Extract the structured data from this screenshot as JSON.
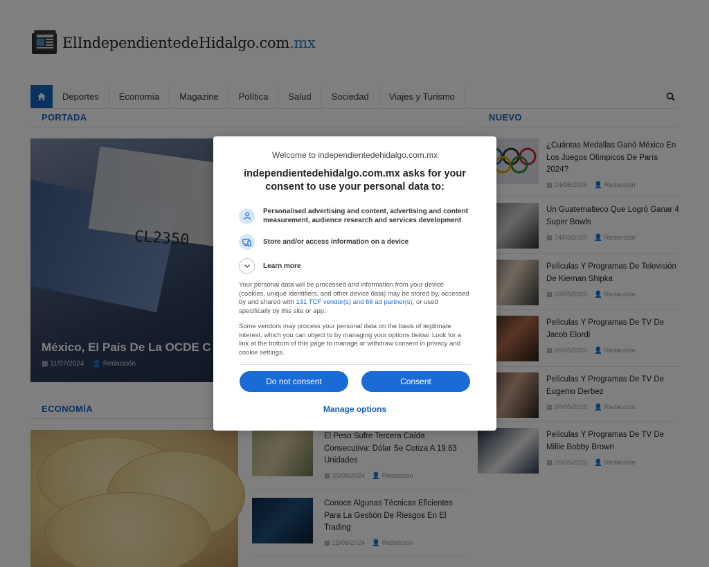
{
  "site": {
    "logo_main": "ElIndependientedeHidalgo.com",
    "logo_tld": ".mx"
  },
  "nav": {
    "items": [
      "Deportes",
      "Economía",
      "Magazine",
      "Política",
      "Salud",
      "Sociedad",
      "Viajes y Turismo"
    ]
  },
  "sections": {
    "portada": "PORTADA",
    "nuevo": "NUEVO",
    "economia": "ECONOMÍA"
  },
  "hero": {
    "serial": "CL2350",
    "title": "México, El País De La OCDE C",
    "date": "11/07/2024",
    "author": "Redacción"
  },
  "nuevo": [
    {
      "title": "¿Cuántas Medallas Ganó México En Los Juegos Olímpicos De París 2024?",
      "date": "24/05/2025",
      "author": "Redacción"
    },
    {
      "title": "Un Guatemalteco Que Logró Ganar 4 Super Bowls",
      "date": "24/05/2025",
      "author": "Redacción"
    },
    {
      "title": "Películas Y Programas De Televisión De Kiernan Shipka",
      "date": "20/05/2025",
      "author": "Redacción"
    },
    {
      "title": "Películas Y Programas De TV De Jacob Elordi",
      "date": "20/05/2025",
      "author": "Redacción"
    },
    {
      "title": "Películas Y Programas De TV De Eugenio Derbez",
      "date": "20/05/2025",
      "author": "Redacción"
    },
    {
      "title": "Películas Y Programas De TV De Millie Bobby Brown",
      "date": "20/05/2025",
      "author": "Redacción"
    }
  ],
  "economia_list": [
    {
      "title": "El Peso Sufre Tercera Caída Consecutiva: Dólar Se Cotiza A 19.83 Unidades",
      "date": "30/08/2024",
      "author": "Redacción"
    },
    {
      "title": "Conoce Algunas Técnicas Eficientes Para La Gestión De Riesgos En El Trading",
      "date": "12/08/2024",
      "author": "Redacción"
    }
  ],
  "consent": {
    "welcome": "Welcome to independientedehidalgo.com.mx",
    "heading": "independientedehidalgo.com.mx asks for your consent to use your personal data to:",
    "purpose_1": "Personalised advertising and content, advertising and content measurement, audience research and services development",
    "purpose_2": "Store and/or access information on a device",
    "learn_more": "Learn more",
    "para_1_a": "Your personal data will be processed and information from your device (cookies, unique identifiers, and other device data) may be stored by, accessed by and shared with ",
    "para_1_link": "131 TCF vendor(s) and 66 ad partner(s)",
    "para_1_b": ", or used specifically by this site or app.",
    "para_2": "Some vendors may process your personal data on the basis of legitimate interest, which you can object to by managing your options below. Look for a link at the bottom of this page to manage or withdraw consent in privacy and cookie settings.",
    "btn_reject": "Do not consent",
    "btn_accept": "Consent",
    "manage": "Manage options"
  },
  "colors": {
    "accent": "#1565c0",
    "button": "#1a6bd6",
    "overlay": "rgba(0,0,0,0.5)"
  }
}
